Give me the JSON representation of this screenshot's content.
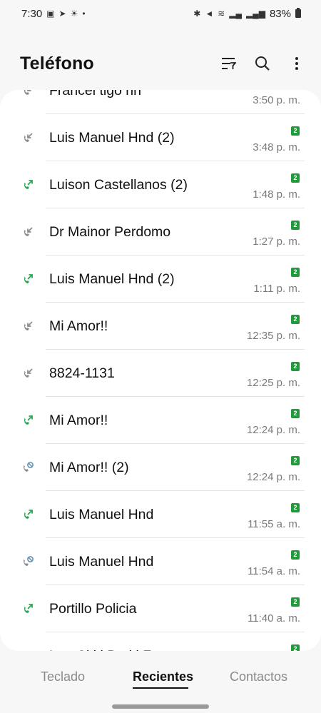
{
  "status_bar": {
    "time": "7:30",
    "battery": "83%"
  },
  "header": {
    "title": "Teléfono"
  },
  "calls": [
    {
      "name": "Francel tigo hn",
      "time": "3:50 p. m.",
      "badge": "",
      "type": "incoming"
    },
    {
      "name": "Luis Manuel Hnd (2)",
      "time": "3:48 p. m.",
      "badge": "2",
      "type": "incoming"
    },
    {
      "name": "Luison Castellanos (2)",
      "time": "1:48 p. m.",
      "badge": "2",
      "type": "outgoing"
    },
    {
      "name": "Dr Mainor Perdomo",
      "time": "1:27 p. m.",
      "badge": "2",
      "type": "incoming"
    },
    {
      "name": "Luis Manuel Hnd (2)",
      "time": "1:11 p. m.",
      "badge": "2",
      "type": "outgoing"
    },
    {
      "name": "Mi Amor!!",
      "time": "12:35 p. m.",
      "badge": "2",
      "type": "incoming"
    },
    {
      "name": "8824-1131",
      "time": "12:25 p. m.",
      "badge": "2",
      "type": "incoming"
    },
    {
      "name": "Mi Amor!!",
      "time": "12:24 p. m.",
      "badge": "2",
      "type": "outgoing"
    },
    {
      "name": "Mi Amor!! (2)",
      "time": "12:24 p. m.",
      "badge": "2",
      "type": "blocked"
    },
    {
      "name": "Luis Manuel Hnd",
      "time": "11:55 a. m.",
      "badge": "2",
      "type": "outgoing"
    },
    {
      "name": "Luis Manuel Hnd",
      "time": "11:54 a. m.",
      "badge": "2",
      "type": "blocked"
    },
    {
      "name": "Portillo Policia",
      "time": "11:40 a. m.",
      "badge": "2",
      "type": "outgoing"
    },
    {
      "name": "Lea Cl.i.l Da.i.l Fa",
      "time": "",
      "badge": "2",
      "type": "outgoing"
    }
  ],
  "tabs": [
    {
      "label": "Teclado",
      "active": false
    },
    {
      "label": "Recientes",
      "active": true
    },
    {
      "label": "Contactos",
      "active": false
    }
  ],
  "colors": {
    "accent_green": "#209a3b",
    "outgoing_icon": "#2aa652",
    "incoming_icon": "#8c8c8c",
    "blocked_icon": "#5b8fb0"
  },
  "icons": {
    "call_incoming": "call-incoming-icon",
    "call_outgoing": "call-outgoing-icon",
    "call_blocked": "call-blocked-icon",
    "header_filter": "filter-icon",
    "header_search": "search-icon",
    "header_more": "more-vertical-icon"
  }
}
